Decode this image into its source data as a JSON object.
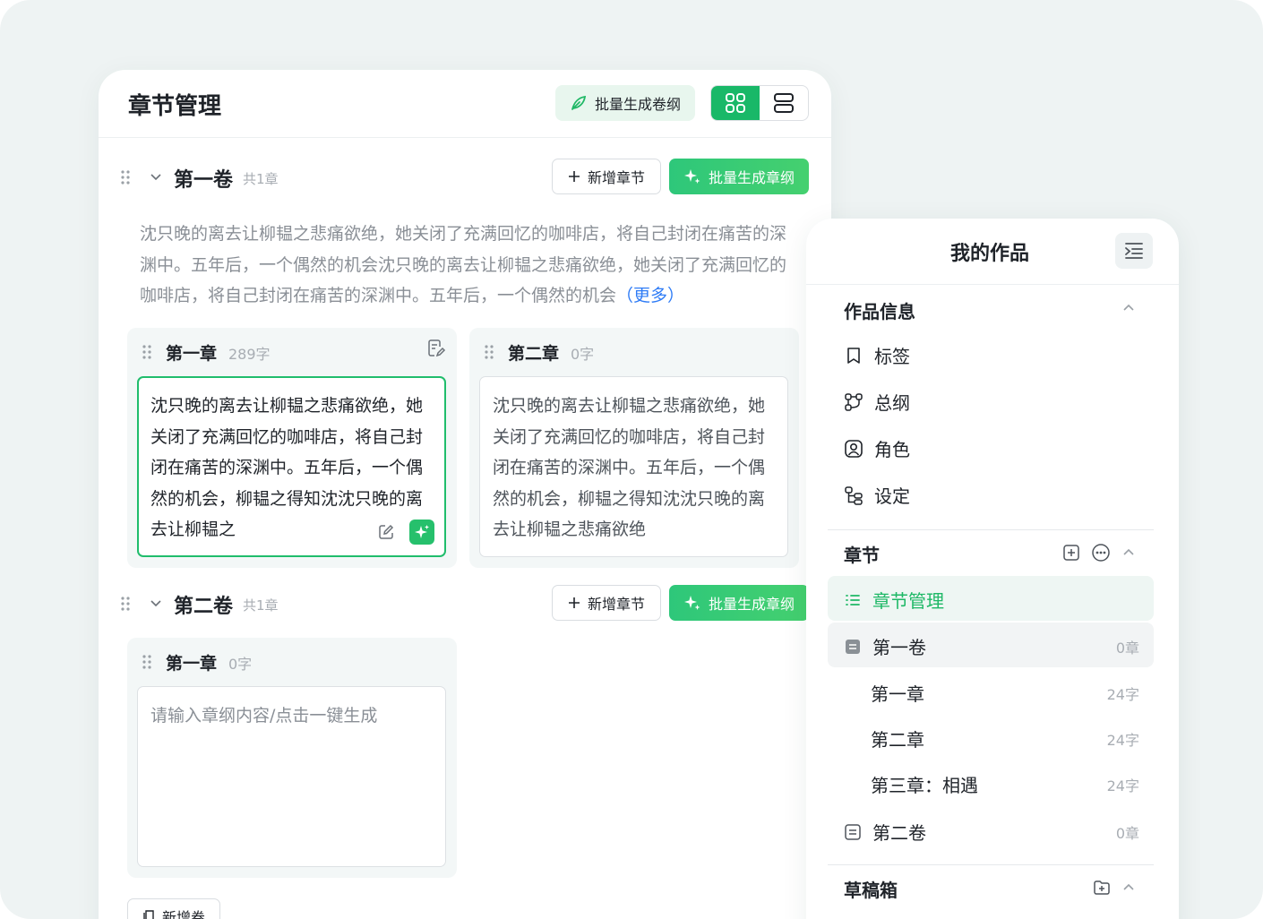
{
  "chapter_panel": {
    "title": "章节管理",
    "batch_volume_outline_label": "批量生成卷纲",
    "volumes": [
      {
        "name": "第一卷",
        "count": "共1章",
        "add_chapter_label": "新增章节",
        "batch_chapter_outline_label": "批量生成章纲",
        "description": "沈只晚的离去让柳韫之悲痛欲绝，她关闭了充满回忆的咖啡店，将自己封闭在痛苦的深渊中。五年后，一个偶然的机会沈只晚的离去让柳韫之悲痛欲绝，她关闭了充满回忆的咖啡店，将自己封闭在痛苦的深渊中。五年后，一个偶然的机会",
        "more_label": "（更多）",
        "chapters": [
          {
            "name": "第一章",
            "count": "289字",
            "text": "沈只晚的离去让柳韫之悲痛欲绝，她关闭了充满回忆的咖啡店，将自己封闭在痛苦的深渊中。五年后，一个偶然的机会，柳韫之得知沈沈只晚的离去让柳韫之"
          },
          {
            "name": "第二章",
            "count": "0字",
            "text": "沈只晚的离去让柳韫之悲痛欲绝，她关闭了充满回忆的咖啡店，将自己封闭在痛苦的深渊中。五年后，一个偶然的机会，柳韫之得知沈沈只晚的离去让柳韫之悲痛欲绝"
          }
        ]
      },
      {
        "name": "第二卷",
        "count": "共1章",
        "add_chapter_label": "新增章节",
        "batch_chapter_outline_label": "批量生成章纲",
        "chapters": [
          {
            "name": "第一章",
            "count": "0字",
            "placeholder": "请输入章纲内容/点击一键生成"
          }
        ]
      }
    ],
    "add_volume_label": "新增卷"
  },
  "works_panel": {
    "title": "我的作品",
    "info_section": {
      "title": "作品信息",
      "items": [
        {
          "label": "标签",
          "icon": "bookmark-icon"
        },
        {
          "label": "总纲",
          "icon": "outline-tree-icon"
        },
        {
          "label": "角色",
          "icon": "person-icon"
        },
        {
          "label": "设定",
          "icon": "settings-tree-icon"
        }
      ]
    },
    "chapter_section": {
      "title": "章节",
      "manage_label": "章节管理",
      "volumes": [
        {
          "name": "第一卷",
          "count": "0章"
        },
        {
          "name": "第二卷",
          "count": "0章"
        }
      ],
      "chapters": [
        {
          "name": "第一章",
          "count": "24字"
        },
        {
          "name": "第二章",
          "count": "24字"
        },
        {
          "name": "第三章：相遇",
          "count": "24字"
        }
      ]
    },
    "draft_section": {
      "title": "草稿箱"
    }
  },
  "colors": {
    "accent": "#1eb866",
    "link": "#2f7cf6",
    "background": "#eef3f3"
  }
}
